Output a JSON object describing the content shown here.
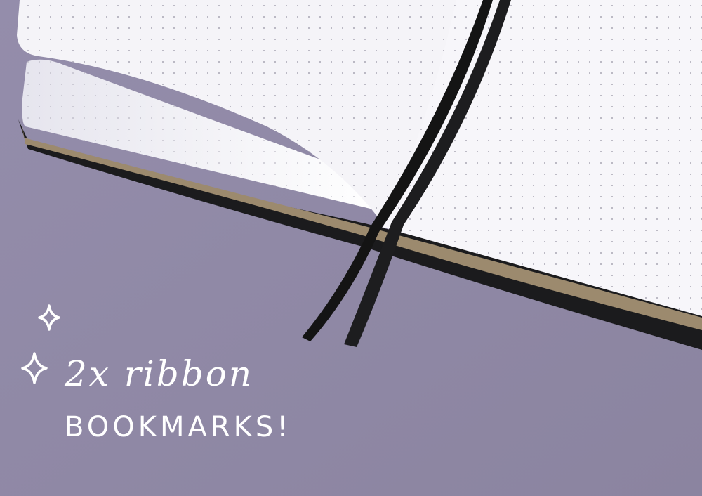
{
  "caption": {
    "line1": "2x ribbon",
    "line2": "BOOKMARKS!"
  },
  "icons": [
    "sparkle-icon",
    "sparkle-icon"
  ],
  "colors": {
    "background": "#8f88a6",
    "page": "#f7f6fa",
    "ribbon": "#141414",
    "cover": "#1b1b1d",
    "page_edge": "#9c8a6e",
    "text": "#ffffff"
  }
}
